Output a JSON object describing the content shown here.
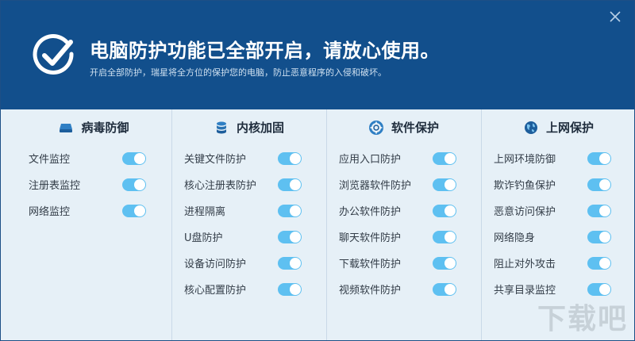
{
  "window": {
    "title": "电脑防护功能已全部开启，请放心使用。",
    "subtitle": "开启全部防护，瑞星将全方位的保护您的电脑，防止恶意程序的入侵和破坏。",
    "close_icon": "close-icon",
    "header_color": "#124f8c",
    "toggle_color": "#5ec0f1"
  },
  "columns": [
    {
      "key": "virus",
      "title": "病毒防御",
      "icon": "drive-icon",
      "items": [
        {
          "label": "文件监控",
          "on": true
        },
        {
          "label": "注册表监控",
          "on": true
        },
        {
          "label": "网络监控",
          "on": true
        }
      ]
    },
    {
      "key": "kernel",
      "title": "内核加固",
      "icon": "database-icon",
      "items": [
        {
          "label": "关键文件防护",
          "on": true
        },
        {
          "label": "核心注册表防护",
          "on": true
        },
        {
          "label": "进程隔离",
          "on": true
        },
        {
          "label": "U盘防护",
          "on": true
        },
        {
          "label": "设备访问防护",
          "on": true
        },
        {
          "label": "核心配置防护",
          "on": true
        }
      ]
    },
    {
      "key": "software",
      "title": "软件保护",
      "icon": "lifebuoy-icon",
      "items": [
        {
          "label": "应用入口防护",
          "on": true
        },
        {
          "label": "浏览器软件防护",
          "on": true
        },
        {
          "label": "办公软件防护",
          "on": true
        },
        {
          "label": "聊天软件防护",
          "on": true
        },
        {
          "label": "下载软件防护",
          "on": true
        },
        {
          "label": "视频软件防护",
          "on": true
        }
      ]
    },
    {
      "key": "web",
      "title": "上网保护",
      "icon": "globe-icon",
      "items": [
        {
          "label": "上网环境防御",
          "on": true
        },
        {
          "label": "欺诈钓鱼保护",
          "on": true
        },
        {
          "label": "恶意访问保护",
          "on": true
        },
        {
          "label": "网络隐身",
          "on": true
        },
        {
          "label": "阻止对外攻击",
          "on": true
        },
        {
          "label": "共享目录监控",
          "on": true
        }
      ]
    }
  ],
  "watermark": "下载吧"
}
